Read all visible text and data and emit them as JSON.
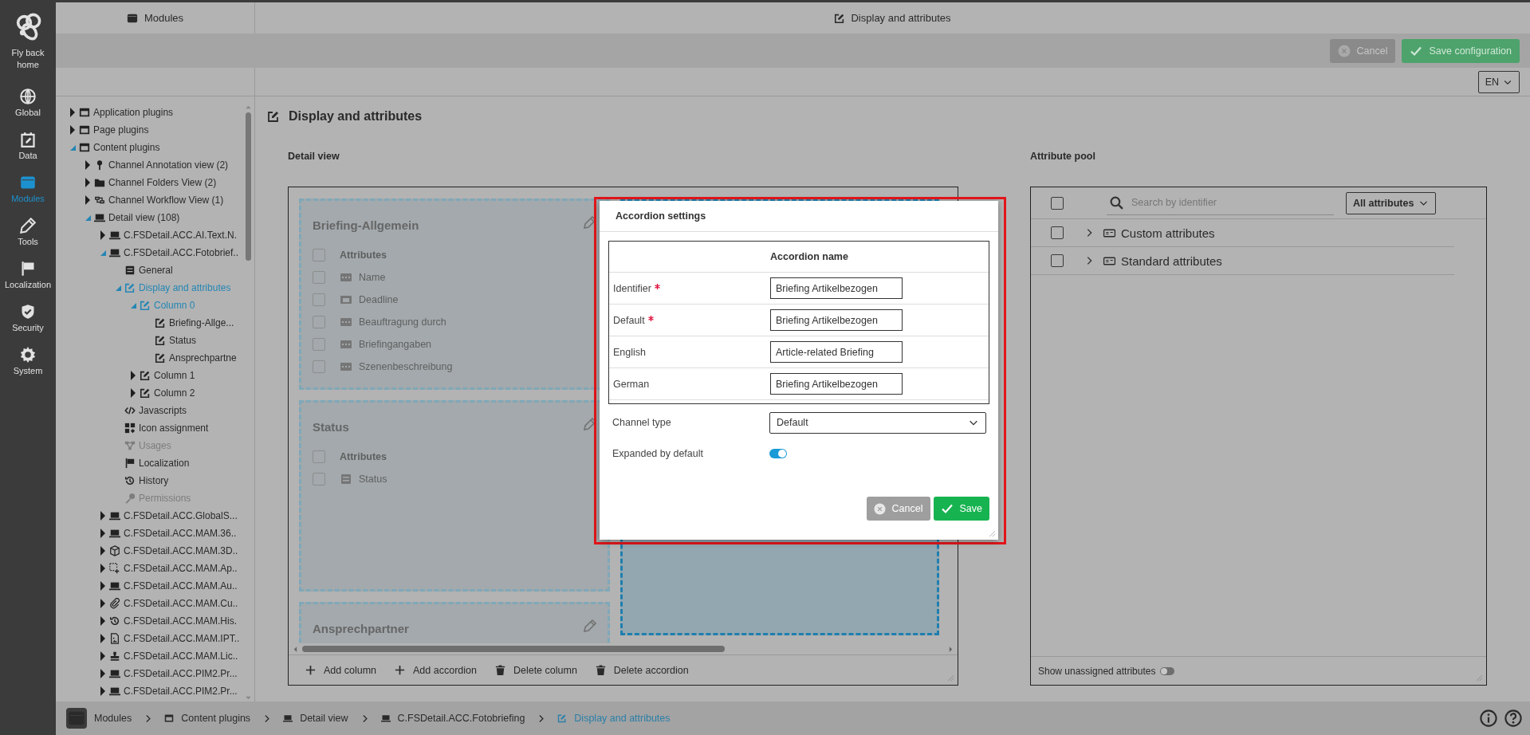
{
  "nav": [
    {
      "label": "Fly back home",
      "kind": "home",
      "selected": false
    },
    {
      "label": "Global",
      "kind": "globe",
      "selected": false
    },
    {
      "label": "Data",
      "kind": "calendar",
      "selected": false
    },
    {
      "label": "Modules",
      "kind": "modules",
      "selected": true
    },
    {
      "label": "Tools",
      "kind": "pencil",
      "selected": false
    },
    {
      "label": "Localization",
      "kind": "flag",
      "selected": false
    },
    {
      "label": "Security",
      "kind": "shield",
      "selected": false
    },
    {
      "label": "System",
      "kind": "gear",
      "selected": false
    }
  ],
  "header": {
    "left_title": "Modules",
    "right_title": "Display and attributes"
  },
  "toolbar": [
    {
      "label": "Cancel",
      "kind": "cancel"
    },
    {
      "label": "Save configuration",
      "kind": "save"
    }
  ],
  "language": "EN",
  "tree": [
    {
      "label": "Application plugins",
      "kind": "window",
      "expanded": false,
      "selected": false,
      "disabled": false
    },
    {
      "label": "Page plugins",
      "kind": "window",
      "expanded": false,
      "selected": false,
      "disabled": false
    },
    {
      "label": "Content plugins",
      "kind": "window",
      "expanded": true,
      "selected": false,
      "disabled": false,
      "children": [
        {
          "label": "Channel Annotation view (2)",
          "kind": "pin",
          "expanded": false,
          "selected": false,
          "disabled": false
        },
        {
          "label": "Channel Folders View (2)",
          "kind": "folder",
          "expanded": false,
          "selected": false,
          "disabled": false
        },
        {
          "label": "Channel Workflow View (1)",
          "kind": "workflow",
          "expanded": false,
          "selected": false,
          "disabled": false
        },
        {
          "label": "Detail view (108)",
          "kind": "monitor",
          "expanded": true,
          "selected": false,
          "disabled": false,
          "children": [
            {
              "label": "C.FSDetail.ACC.AI.Text.N.",
              "kind": "monitor",
              "expanded": false,
              "selected": false,
              "disabled": false
            },
            {
              "label": "C.FSDetail.ACC.Fotobrief..",
              "kind": "monitor",
              "expanded": true,
              "selected": false,
              "disabled": false,
              "children": [
                {
                  "label": "General",
                  "kind": "list",
                  "selected": false,
                  "disabled": false
                },
                {
                  "label": "Display and attributes",
                  "kind": "edit",
                  "expanded": true,
                  "selected": true,
                  "disabled": false,
                  "children": [
                    {
                      "label": "Column 0",
                      "kind": "edit",
                      "expanded": true,
                      "selected": true,
                      "disabled": false,
                      "children": [
                        {
                          "label": "Briefing-Allge...",
                          "kind": "edit",
                          "selected": false,
                          "disabled": false
                        },
                        {
                          "label": "Status",
                          "kind": "edit",
                          "selected": false,
                          "disabled": false
                        },
                        {
                          "label": "Ansprechpartne",
                          "kind": "edit",
                          "selected": false,
                          "disabled": false
                        }
                      ]
                    },
                    {
                      "label": "Column 1",
                      "kind": "edit",
                      "expanded": false,
                      "selected": false,
                      "disabled": false
                    },
                    {
                      "label": "Column 2",
                      "kind": "edit",
                      "expanded": false,
                      "selected": false,
                      "disabled": false
                    }
                  ]
                },
                {
                  "label": "Javascripts",
                  "kind": "code",
                  "selected": false,
                  "disabled": false
                },
                {
                  "label": "Icon assignment",
                  "kind": "shapes",
                  "selected": false,
                  "disabled": false
                },
                {
                  "label": "Usages",
                  "kind": "network",
                  "selected": false,
                  "disabled": true
                },
                {
                  "label": "Localization",
                  "kind": "flag",
                  "selected": false,
                  "disabled": false
                },
                {
                  "label": "History",
                  "kind": "history",
                  "selected": false,
                  "disabled": false
                },
                {
                  "label": "Permissions",
                  "kind": "key",
                  "selected": false,
                  "disabled": true
                }
              ]
            },
            {
              "label": "C.FSDetail.ACC.GlobalS...",
              "kind": "monitor",
              "expanded": false,
              "selected": false,
              "disabled": false
            },
            {
              "label": "C.FSDetail.ACC.MAM.36..",
              "kind": "monitor",
              "expanded": false,
              "selected": false,
              "disabled": false
            },
            {
              "label": "C.FSDetail.ACC.MAM.3D..",
              "kind": "cube",
              "expanded": false,
              "selected": false,
              "disabled": false
            },
            {
              "label": "C.FSDetail.ACC.MAM.Ap..",
              "kind": "selection",
              "expanded": false,
              "selected": false,
              "disabled": false
            },
            {
              "label": "C.FSDetail.ACC.MAM.Au..",
              "kind": "monitor",
              "expanded": false,
              "selected": false,
              "disabled": false
            },
            {
              "label": "C.FSDetail.ACC.MAM.Cu..",
              "kind": "clip",
              "expanded": false,
              "selected": false,
              "disabled": false
            },
            {
              "label": "C.FSDetail.ACC.MAM.His.",
              "kind": "history",
              "expanded": false,
              "selected": false,
              "disabled": false
            },
            {
              "label": "C.FSDetail.ACC.MAM.IPT..",
              "kind": "image",
              "expanded": false,
              "selected": false,
              "disabled": false
            },
            {
              "label": "C.FSDetail.ACC.MAM.Lic..",
              "kind": "stamp",
              "expanded": false,
              "selected": false,
              "disabled": false
            },
            {
              "label": "C.FSDetail.ACC.PIM2.Pr...",
              "kind": "monitor",
              "expanded": false,
              "selected": false,
              "disabled": false
            },
            {
              "label": "C.FSDetail.ACC.PIM2.Pr...",
              "kind": "monitor",
              "expanded": false,
              "selected": false,
              "disabled": false
            }
          ]
        }
      ]
    }
  ],
  "page_title": "Display and attributes",
  "detail_view": {
    "title": "Detail view",
    "columns": [
      {
        "accordions": [
          {
            "title": "Briefing-Allgemein",
            "selected": false,
            "rows": [
              {
                "label": "Attributes",
                "kind": "header",
                "checked": false
              },
              {
                "label": "Name",
                "kind": "text",
                "checked": false
              },
              {
                "label": "Deadline",
                "kind": "date",
                "checked": false
              },
              {
                "label": "Beauftragung durch",
                "kind": "text",
                "checked": false
              },
              {
                "label": "Briefingangaben",
                "kind": "text",
                "checked": false
              },
              {
                "label": "Szenenbeschreibung",
                "kind": "text",
                "checked": false
              }
            ]
          },
          {
            "title": "Status",
            "selected": false,
            "rows": [
              {
                "label": "Attributes",
                "kind": "header",
                "checked": false
              },
              {
                "label": "Status",
                "kind": "list",
                "checked": false
              }
            ]
          },
          {
            "title": "Ansprechpartner",
            "selected": false
          }
        ]
      },
      {
        "accordions": [
          {
            "selected": true
          }
        ]
      }
    ],
    "actions": [
      {
        "label": "Add column",
        "kind": "add"
      },
      {
        "label": "Add accordion",
        "kind": "add"
      },
      {
        "label": "Delete column",
        "kind": "delete"
      },
      {
        "label": "Delete accordion",
        "kind": "delete"
      }
    ]
  },
  "attribute_pool": {
    "title": "Attribute pool",
    "select_all_checked": false,
    "search_placeholder": "Search by identifier",
    "filter": "All attributes",
    "groups": [
      {
        "label": "Custom attributes",
        "checked": false,
        "expanded": false
      },
      {
        "label": "Standard attributes",
        "checked": false,
        "expanded": false
      }
    ],
    "footer": {
      "label": "Show unassigned attributes",
      "on": false
    }
  },
  "dialog": {
    "title": "Accordion settings",
    "highlighted": true,
    "column_header": "Accordion name",
    "rows": [
      {
        "label": "Identifier",
        "required": true,
        "value": "Briefing Artikelbezogen"
      },
      {
        "label": "Default",
        "required": true,
        "value": "Briefing Artikelbezogen"
      },
      {
        "label": "English",
        "required": false,
        "value": "Article-related Briefing"
      },
      {
        "label": "German",
        "required": false,
        "value": "Briefing Artikelbezogen"
      }
    ],
    "channel_type": {
      "label": "Channel type",
      "value": "Default"
    },
    "expanded": {
      "label": "Expanded by default",
      "on": true
    },
    "buttons": [
      {
        "label": "Cancel",
        "kind": "cancel"
      },
      {
        "label": "Save",
        "kind": "save"
      }
    ]
  },
  "breadcrumb": [
    {
      "label": "Modules",
      "kind": "modules",
      "selected": false
    },
    {
      "label": "Content plugins",
      "kind": "window",
      "selected": false
    },
    {
      "label": "Detail view",
      "kind": "monitor",
      "selected": false
    },
    {
      "label": "C.FSDetail.ACC.Fotobriefing",
      "kind": "monitor",
      "selected": false
    },
    {
      "label": "Display and attributes",
      "kind": "edit",
      "selected": true
    }
  ]
}
